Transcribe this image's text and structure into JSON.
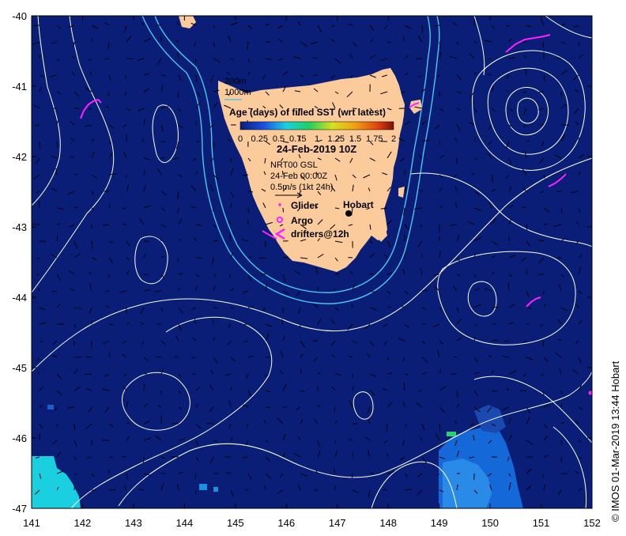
{
  "map": {
    "title": "24-Feb-2019 10Z",
    "colorbar_title": "Age (days) of filled SST (wrt latest)",
    "colorbar_ticks": [
      "0",
      "0.25",
      "0.5",
      "0.75",
      "1",
      "1.25",
      "1.5",
      "1.75",
      "2"
    ],
    "product": "NRT00 GSL",
    "product_time": "24-Feb 00:00Z",
    "current_scale": "0.5m/s (1kt 24h)",
    "depth_legend": [
      "200m",
      "1000m"
    ],
    "place_label": "Hobart",
    "credit": "IMOS 01-Mar-2019 13:44 Hobart",
    "copyright_symbol": "©"
  },
  "legend": {
    "glider": "Glider",
    "argo": "Argo",
    "drifters": "drifters@12h"
  },
  "axes": {
    "x_ticks": [
      "141",
      "142",
      "143",
      "144",
      "145",
      "146",
      "147",
      "148",
      "149",
      "150",
      "151",
      "152"
    ],
    "y_ticks": [
      "-40",
      "-41",
      "-42",
      "-43",
      "-44",
      "-45",
      "-46",
      "-47"
    ],
    "x_range": [
      141,
      152
    ],
    "y_range": [
      -47,
      -40
    ]
  },
  "colors": {
    "ocean": "#0a1e78",
    "land": "#fccb9c",
    "contour": "#ffffff",
    "isobath": "#4cc8e8",
    "drifter": "#ff22ff",
    "age_cyan": "#1ad0e0",
    "age_blue": "#1468d8",
    "age_light": "#2a8ae8"
  }
}
